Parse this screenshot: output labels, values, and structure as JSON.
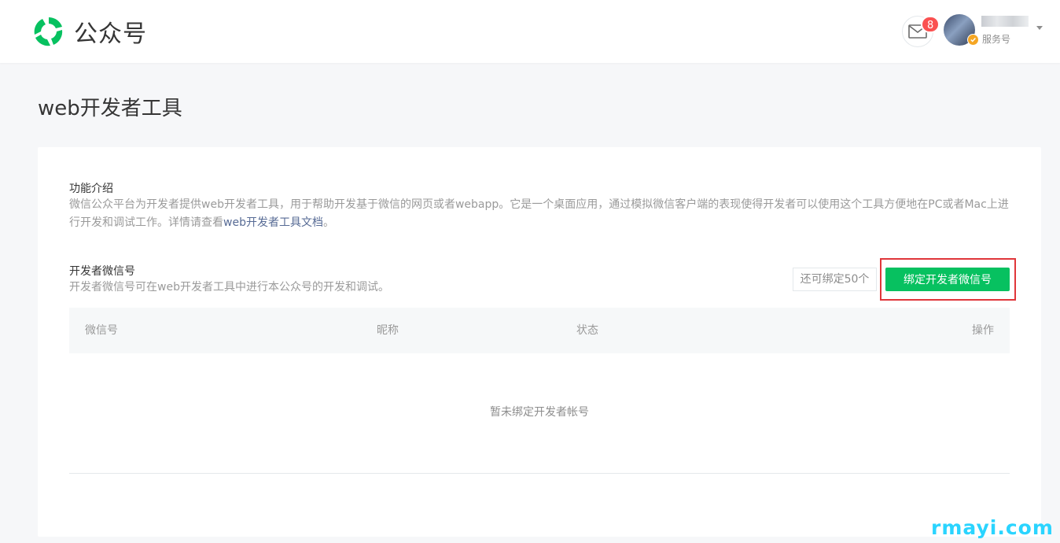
{
  "header": {
    "brand": "公众号",
    "notification_count": "8",
    "account_type": "服务号"
  },
  "page": {
    "title": "web开发者工具"
  },
  "intro": {
    "title": "功能介绍",
    "desc_line1": "微信公众平台为开发者提供web开发者工具，用于帮助开发基于微信的网页或者webapp。它是一个桌面应用，通过模拟微信客户端的表现使得开发者可以使用这个工具方便地在PC或者Mac上进",
    "desc_line2_prefix": "行开发和调试工作。详情请查看",
    "doc_link": "web开发者工具文档",
    "desc_line2_suffix": "。"
  },
  "developer": {
    "title": "开发者微信号",
    "desc": "开发者微信号可在web开发者工具中进行本公众号的开发和调试。",
    "quota": "还可绑定50个",
    "bind_button": "绑定开发者微信号"
  },
  "table": {
    "columns": [
      "微信号",
      "昵称",
      "状态",
      "操作"
    ],
    "empty_text": "暂未绑定开发者帐号"
  },
  "watermark": "rmayi.com",
  "colors": {
    "accent": "#07c160",
    "badge": "#fa5151",
    "highlight": "#e0363a",
    "link": "#576b95"
  },
  "icons": {
    "logo": "wechat-official-account-logo",
    "mail": "mail-icon",
    "verified": "verified-badge-icon",
    "caret": "caret-down-icon"
  }
}
